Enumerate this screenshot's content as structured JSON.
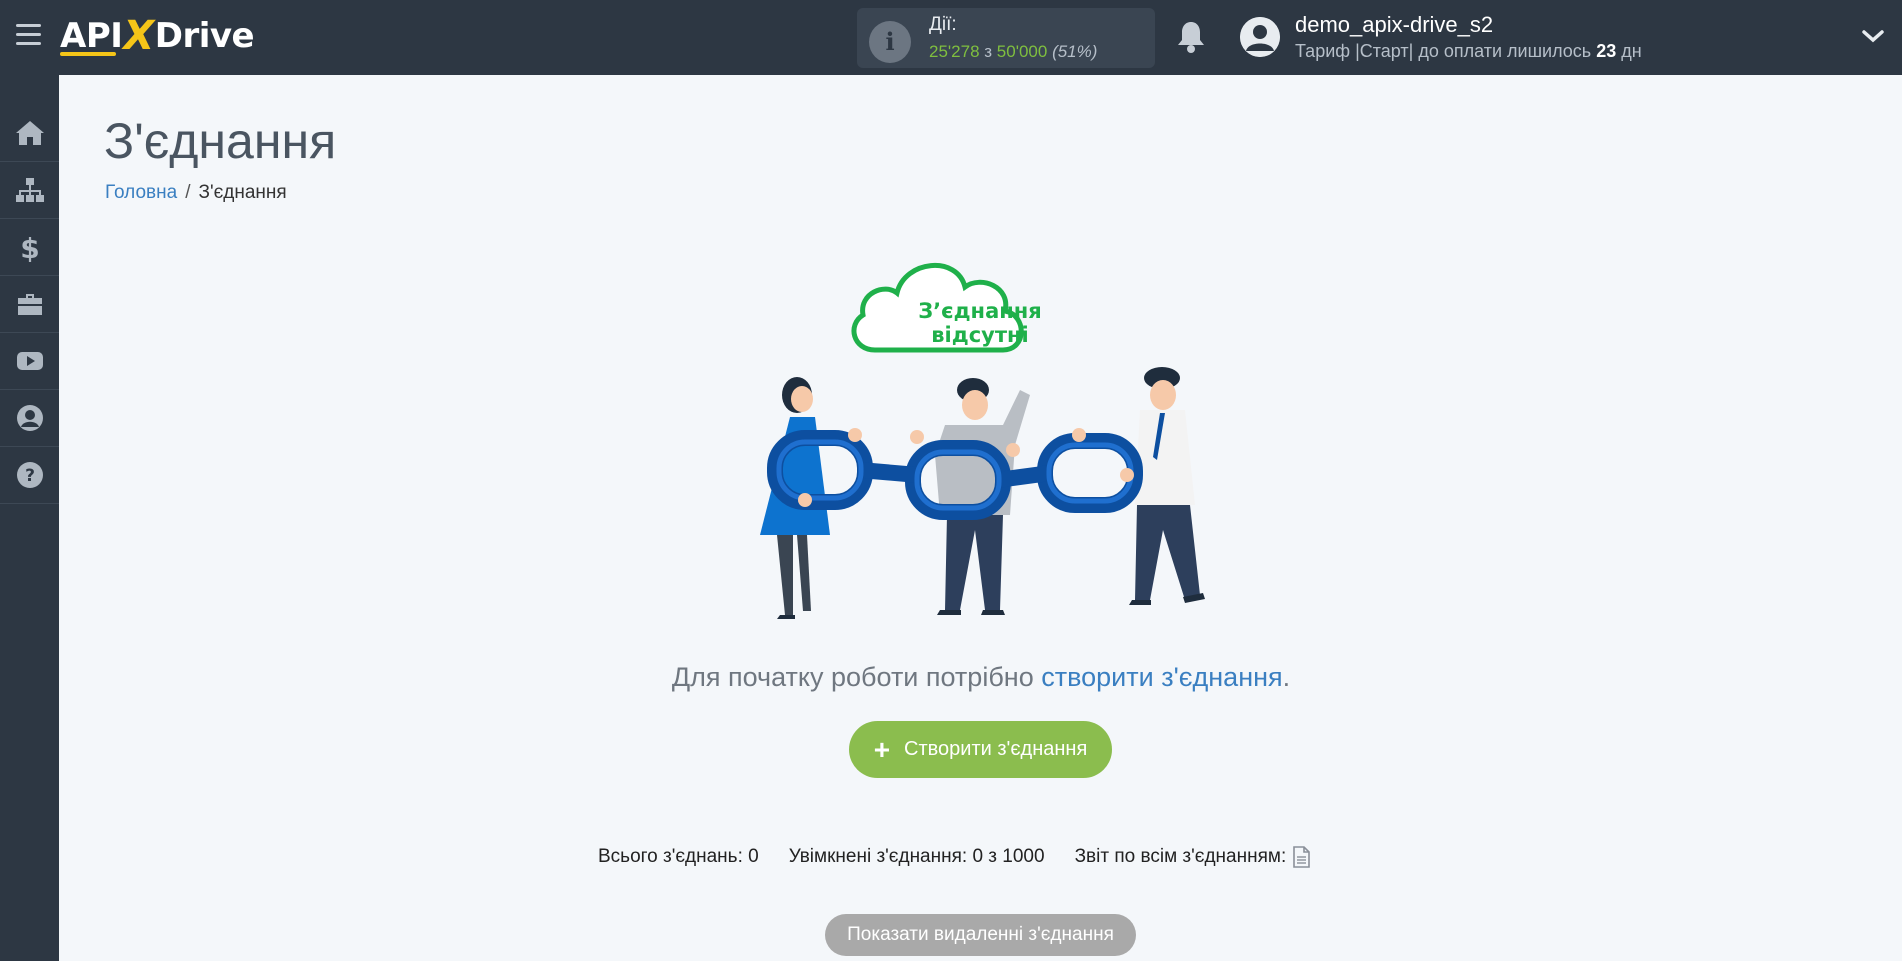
{
  "header": {
    "logo": {
      "api": "API",
      "x": "X",
      "drive": "Drive"
    },
    "actions": {
      "label": "Дії:",
      "used": "25'278",
      "of": "з",
      "total": "50'000",
      "percent": "(51%)"
    },
    "user": {
      "name": "demo_apix-drive_s2",
      "plan_prefix": "Тариф |Старт| до оплати лишилось",
      "days": "23",
      "days_suffix": "дн"
    }
  },
  "sidebar": {
    "items": [
      {
        "icon": "home-icon"
      },
      {
        "icon": "sitemap-icon"
      },
      {
        "icon": "dollar-icon"
      },
      {
        "icon": "briefcase-icon"
      },
      {
        "icon": "youtube-icon"
      },
      {
        "icon": "user-circle-icon"
      },
      {
        "icon": "question-circle-icon"
      }
    ]
  },
  "main": {
    "title": "З'єднання",
    "breadcrumb": {
      "home": "Головна",
      "separator": "/",
      "current": "З'єднання"
    },
    "illustration": {
      "cloud_line1": "З’єднання",
      "cloud_line2": "відсутні"
    },
    "empty_msg": {
      "prefix": "Для початку роботи потрібно",
      "link": "створити з'єднання",
      "suffix": "."
    },
    "create_button": {
      "plus": "+",
      "label": "Створити з'єднання"
    },
    "stats": {
      "total": "Всього з'єднань: 0",
      "enabled": "Увімкнені з'єднання: 0 з 1000",
      "report": "Звіт по всім з'єднанням:"
    },
    "deleted_button": "Показати видаленні з'єднання"
  },
  "colors": {
    "topbar": "#2d3743",
    "accent_green": "#8bbd4e",
    "link_blue": "#3a7fc1",
    "logo_yellow": "#f5c518",
    "cloud_green": "#1fb04a",
    "chain_blue": "#0d4fa0"
  }
}
